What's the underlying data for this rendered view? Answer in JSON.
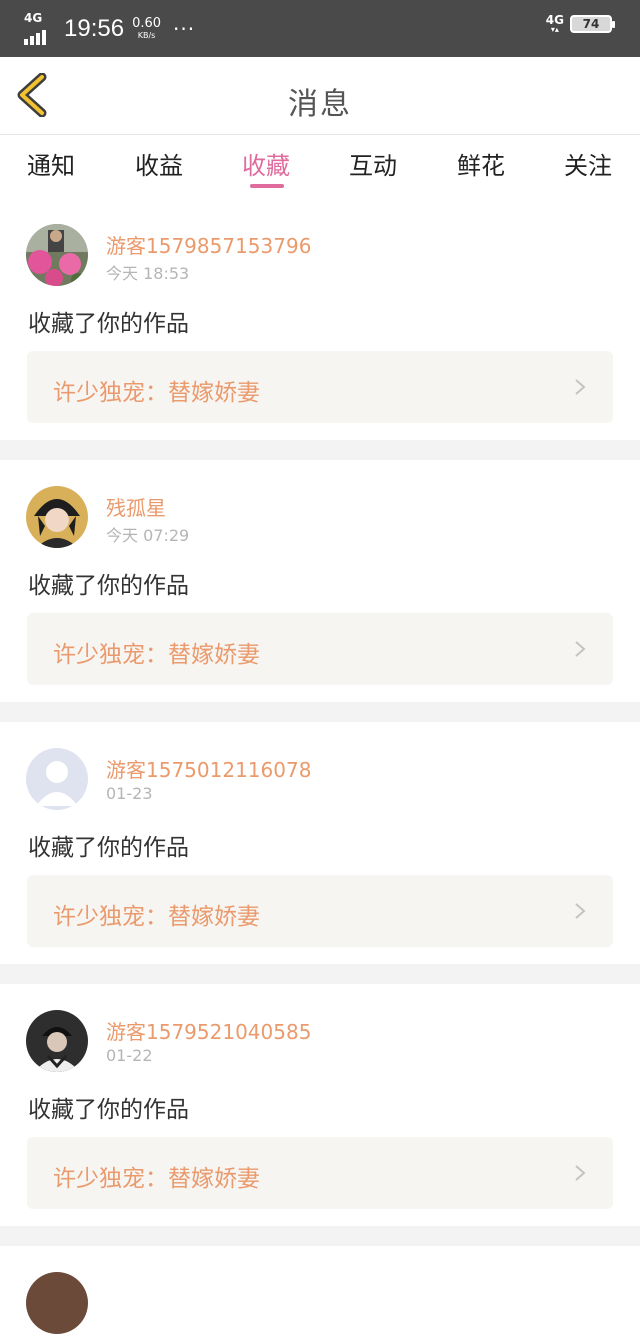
{
  "status_bar": {
    "network": "4G",
    "time": "19:56",
    "speed_value": "0.60",
    "speed_unit": "KB/s",
    "more": "···",
    "right_network": "4G",
    "battery": "74"
  },
  "header": {
    "title": "消息"
  },
  "tabs": [
    {
      "label": "通知"
    },
    {
      "label": "收益"
    },
    {
      "label": "收藏"
    },
    {
      "label": "互动"
    },
    {
      "label": "鲜花"
    },
    {
      "label": "关注"
    }
  ],
  "active_tab": "收藏",
  "colors": {
    "accent": "#e06b9d",
    "username": "#ea9a6c",
    "status_bar": "#4a4a4a"
  },
  "items": [
    {
      "user": "游客1579857153796",
      "time": "今天 18:53",
      "action": "收藏了你的作品",
      "work": "许少独宠：替嫁娇妻"
    },
    {
      "user": "残孤星",
      "time": "今天 07:29",
      "action": "收藏了你的作品",
      "work": "许少独宠：替嫁娇妻"
    },
    {
      "user": "游客1575012116078",
      "time": "01-23",
      "action": "收藏了你的作品",
      "work": "许少独宠：替嫁娇妻"
    },
    {
      "user": "游客1579521040585",
      "time": "01-22",
      "action": "收藏了你的作品",
      "work": "许少独宠：替嫁娇妻"
    }
  ]
}
